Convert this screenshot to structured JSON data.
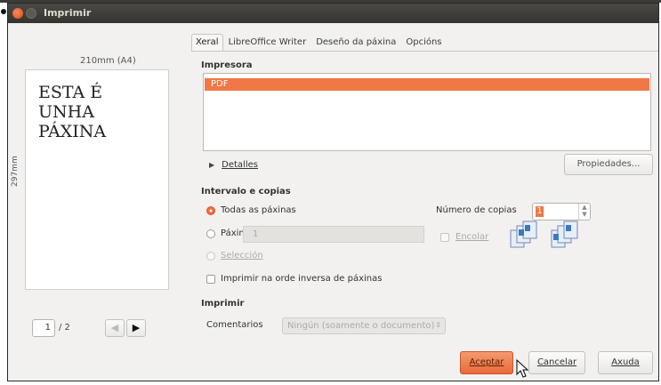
{
  "window": {
    "title": "Imprimir"
  },
  "preview": {
    "width_label": "210mm (A4)",
    "height_label": "297mm",
    "page_text": [
      "ESTA É",
      "UNHA",
      "PÁXINA"
    ],
    "current_page": "1",
    "total_pages": "/ 2"
  },
  "tabs": [
    {
      "label": "Xeral"
    },
    {
      "label": "LibreOffice Writer"
    },
    {
      "label": "Deseño da páxina"
    },
    {
      "label": "Opcións"
    }
  ],
  "printer": {
    "section_title": "Impresora",
    "items": [
      "PDF"
    ],
    "selected": "PDF",
    "details_label": "Detalles",
    "properties_button": "Propiedades..."
  },
  "range": {
    "section_title": "Intervalo e copias",
    "all_pages": "Todas as páxinas",
    "pages_label": "Páxinas",
    "pages_value": "1",
    "selection": "Selección",
    "reverse_order": "Imprimir na orde inversa de páxinas",
    "copies_label": "Número de copias",
    "copies_value": "1",
    "collate_label": "Encolar"
  },
  "print_section": {
    "section_title": "Imprimir",
    "comments_label": "Comentarios",
    "comments_value": "Ningún (soamente o documento)"
  },
  "buttons": {
    "ok": "Aceptar",
    "cancel": "Cancelar",
    "help": "Axuda"
  },
  "colors": {
    "accent": "#f07746",
    "titlebar": "#3c3b37",
    "window_bg": "#f2f1f0"
  }
}
